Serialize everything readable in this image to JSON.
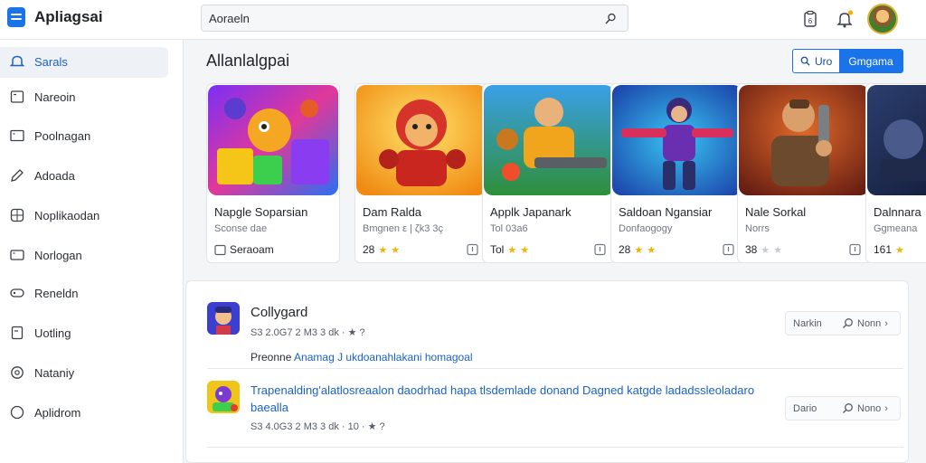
{
  "app": {
    "name": "Apliagsai"
  },
  "search": {
    "value": "Aoraeln"
  },
  "sidebar": {
    "items": [
      {
        "label": "Sarals",
        "icon": "bell-icon",
        "active": true
      },
      {
        "label": "Nareoin",
        "icon": "square-icon",
        "active": false
      },
      {
        "label": "Poolnagan",
        "icon": "rectangle-icon",
        "active": false
      },
      {
        "label": "Adoada",
        "icon": "pen-icon",
        "active": false
      },
      {
        "label": "Noplikaodan",
        "icon": "grid-icon",
        "active": false
      },
      {
        "label": "Norlogan",
        "icon": "rectangle-icon",
        "active": false
      },
      {
        "label": "Reneldn",
        "icon": "pill-icon",
        "active": false
      },
      {
        "label": "Uotling",
        "icon": "document-icon",
        "active": false
      },
      {
        "label": "Nataniy",
        "icon": "gear-icon",
        "active": false
      },
      {
        "label": "Aplidrom",
        "icon": "circle-icon",
        "active": false
      }
    ]
  },
  "featured": {
    "title": "Allanlalgpai",
    "seg_left": "Uro",
    "seg_right": "Gmgama",
    "cards": [
      {
        "name": "Napgle Soparsian",
        "sub": "Sconse dae",
        "rating": "Seraoam",
        "stars": 0
      },
      {
        "name": "Dam Ralda",
        "sub": "Bmgnen ε | ζk3 3ç",
        "rating": "28",
        "stars": 2
      },
      {
        "name": "Applk Japanark",
        "sub": "Tol 03a6",
        "rating": "Tol",
        "stars": 2
      },
      {
        "name": "Saldoan Ngansiar",
        "sub": "Donfaogogy",
        "rating": "28",
        "stars": 2
      },
      {
        "name": "Nale Sorkal",
        "sub": "Norrs",
        "rating": "38",
        "stars": 2
      },
      {
        "name": "Dalnnara",
        "sub": "Ggmeana",
        "rating": "161",
        "stars": 1
      }
    ]
  },
  "list": {
    "rows": [
      {
        "title": "Collygard",
        "meta": "S3 2.0G7 2 M3 3 dk · ★ ?",
        "body_prefix": "Preonne",
        "body_link": "Anamag J ukdoanahlakani homagoal",
        "actions_label": "Narkin",
        "action_btn": "Nonn"
      },
      {
        "title": "Trapenalding'alatlosreaalon daodrhad hapa tlsdemlade donand Dagned katgde ladadssleoladaro baealla",
        "meta": "S3 4.0G3 2 M3 3 dk · 10 · ★ ?",
        "actions_label": "Dario",
        "action_btn": "Nono"
      }
    ]
  },
  "colors": {
    "accent": "#1a73e8",
    "link": "#1a62c9",
    "star": "#f2b400"
  }
}
